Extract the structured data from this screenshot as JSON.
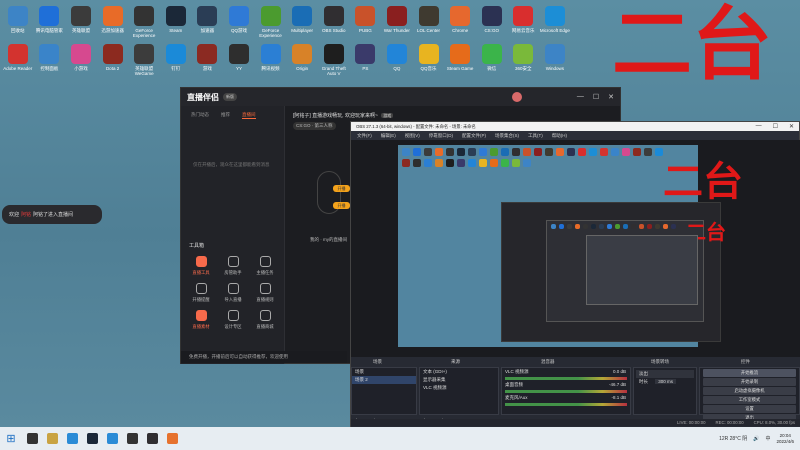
{
  "desktop": {
    "icons": [
      {
        "label": "回收站",
        "icon": "recycle-bin-icon",
        "color": "#3d84c6"
      },
      {
        "label": "腾讯电脑管家",
        "icon": "shield-icon",
        "color": "#1f6fd8"
      },
      {
        "label": "英雄联盟",
        "icon": "lol-icon",
        "color": "#3b3b3b"
      },
      {
        "label": "迅游加速器",
        "icon": "game-icon",
        "color": "#e86b28"
      },
      {
        "label": "GeForce Experience",
        "icon": "g-icon",
        "color": "#333"
      },
      {
        "label": "Steam",
        "icon": "steam-icon",
        "color": "#1b2838"
      },
      {
        "label": "加速器",
        "icon": "spark-icon",
        "color": "#2a3d55"
      },
      {
        "label": "QQ游戏",
        "icon": "qq-game-icon",
        "color": "#2f7ad6"
      },
      {
        "label": "GeForce Experience",
        "icon": "nvidia-icon",
        "color": "#4b9b2f"
      },
      {
        "label": "Multiplayer",
        "icon": "multiplayer-icon",
        "color": "#1a6db5"
      },
      {
        "label": "OBS Studio",
        "icon": "obs-icon",
        "color": "#302e31"
      },
      {
        "label": "PUBG",
        "icon": "pubg-icon",
        "color": "#c9522a"
      },
      {
        "label": "War Thunder",
        "icon": "war-icon",
        "color": "#8a1f1f"
      },
      {
        "label": "LOL Center",
        "icon": "lol-icon",
        "color": "#3f3a30"
      },
      {
        "label": "Chrome",
        "icon": "browser-icon",
        "color": "#e6682e"
      },
      {
        "label": "CS:GO",
        "icon": "csgo-icon",
        "color": "#2b3152"
      },
      {
        "label": "网易云音乐",
        "icon": "music-icon",
        "color": "#d92e2e"
      },
      {
        "label": "Microsoft Edge",
        "icon": "edge-icon",
        "color": "#1c8ed6"
      },
      {
        "label": "Adobe Reader",
        "icon": "pdf-icon",
        "color": "#d3332f"
      },
      {
        "label": "控制面板",
        "icon": "control-panel-icon",
        "color": "#3a84c9"
      },
      {
        "label": "小游戏",
        "icon": "colorful-icon",
        "color": "#d6498f"
      },
      {
        "label": "Dota 2",
        "icon": "dota-icon",
        "color": "#8c2a1f"
      },
      {
        "label": "英雄联盟 WeGame",
        "icon": "wegame-icon",
        "color": "#3c3c3c"
      },
      {
        "label": "钉钉",
        "icon": "chat-icon",
        "color": "#1b8ad8"
      },
      {
        "label": "游戏",
        "icon": "game-icon",
        "color": "#8b2a22"
      },
      {
        "label": "YY",
        "icon": "yy-icon",
        "color": "#2e2e2e"
      },
      {
        "label": "腾讯视频",
        "icon": "video-icon",
        "color": "#2b7fd4"
      },
      {
        "label": "Origin",
        "icon": "origin-icon",
        "color": "#d88228"
      },
      {
        "label": "Grand Theft Auto V",
        "icon": "gta-icon",
        "color": "#1e1e1e"
      },
      {
        "label": "PS",
        "icon": "ps-icon",
        "color": "#3a3a6a"
      },
      {
        "label": "QQ",
        "icon": "qq-icon",
        "color": "#2285d8"
      },
      {
        "label": "QQ音乐",
        "icon": "yellow-icon",
        "color": "#e8b420"
      },
      {
        "label": "Steam Game",
        "icon": "steam-game-icon",
        "color": "#e66b1a"
      },
      {
        "label": "微信",
        "icon": "wechat-icon",
        "color": "#3bb44a"
      },
      {
        "label": "360安全",
        "icon": "security-icon",
        "color": "#7ab93a"
      },
      {
        "label": "Windows",
        "icon": "window-icon",
        "color": "#3d84c6"
      }
    ],
    "overlay_text_1": "二台",
    "overlay_text_2": "二台",
    "overlay_text_3": "二台",
    "toast": {
      "prefix": "欢迎",
      "name": "阿铭",
      "suffix": "阿铭了进入直播间"
    }
  },
  "live_app": {
    "title": "直播伴侣",
    "version": "新版",
    "tabs": [
      "热门动态",
      "推荐",
      "直播间"
    ],
    "active_tab": 2,
    "empty_msg": "仅在开播后，观众在这里都能看到消息",
    "room_title": "[阿铭子] 直播游戏畅玩, 欢迎玩家来啊~",
    "room_tag": "游戏",
    "category": "CS:GO · 第三人称",
    "pill1": "开播",
    "pill2": "开播",
    "caption": "我的 · my的直播间",
    "tools_title": "工具箱",
    "tools": [
      {
        "label": "直播工具",
        "hot": true
      },
      {
        "label": "房管助手",
        "hot": false
      },
      {
        "label": "主播任务",
        "hot": false
      },
      {
        "label": "开播提醒",
        "hot": false
      },
      {
        "label": "导入直播",
        "hot": false
      },
      {
        "label": "直播规则",
        "hot": false
      },
      {
        "label": "直播素材",
        "hot": true
      },
      {
        "label": "设计专区",
        "hot": false
      },
      {
        "label": "直播商城",
        "hot": false
      }
    ],
    "notice": "免费开播，开播前后可以自动获得推荐，欢迎使用"
  },
  "obs": {
    "title": "OBS 27.1.3 (64-bit, windows) - 配置文件: 未命名 - 场景: 未命名",
    "menu": [
      "文件(F)",
      "编辑(E)",
      "视图(V)",
      "停靠窗口(D)",
      "配置文件(P)",
      "场景集合(S)",
      "工具(T)",
      "帮助(H)"
    ],
    "docks": {
      "scenes_title": "场景",
      "scenes": [
        "场景",
        "场景 2"
      ],
      "sources_title": "来源",
      "sources": [
        "文本 (GDI+)",
        "显示器采集",
        "VLC 视频源"
      ],
      "mixer_title": "混音器",
      "mixer": [
        {
          "name": "VLC 视频源",
          "db": "0.0 dB"
        },
        {
          "name": "桌面音频",
          "db": "-46.7 dB"
        },
        {
          "name": "麦克风/Aux",
          "db": "-8.1 dB"
        }
      ],
      "transitions_title": "场景转场",
      "transition_type": "淡出",
      "duration_label": "时长",
      "duration_value": "300 ms",
      "controls_title": "控件",
      "controls": [
        "开始推流",
        "开始录制",
        "启动虚拟摄像机",
        "工作室模式",
        "设置",
        "退出"
      ]
    },
    "status": [
      "LIVE: 00:00:00",
      "REC: 00:00:00",
      "CPU: 8.0%, 30.00 fps"
    ]
  },
  "taskbar": {
    "apps": [
      {
        "icon": "search-icon",
        "color": "#333"
      },
      {
        "icon": "lol-icon",
        "color": "#c9a342"
      },
      {
        "icon": "edge-icon",
        "color": "#2a8bd6"
      },
      {
        "icon": "steam-icon",
        "color": "#1b2838"
      },
      {
        "icon": "qq-icon",
        "color": "#2a8bd6"
      },
      {
        "icon": "wegame-icon",
        "color": "#333"
      },
      {
        "icon": "obs-icon",
        "color": "#302e31"
      },
      {
        "icon": "live-app-icon",
        "color": "#e6722e"
      }
    ],
    "weather": "12R 28°C 阴",
    "lang": "中",
    "time": "20:04",
    "date": "2022/4/6"
  },
  "colors": {
    "accent": "#fb6a3b",
    "overlay_red": "#e01818",
    "obs_bg": "#2b2e38"
  }
}
